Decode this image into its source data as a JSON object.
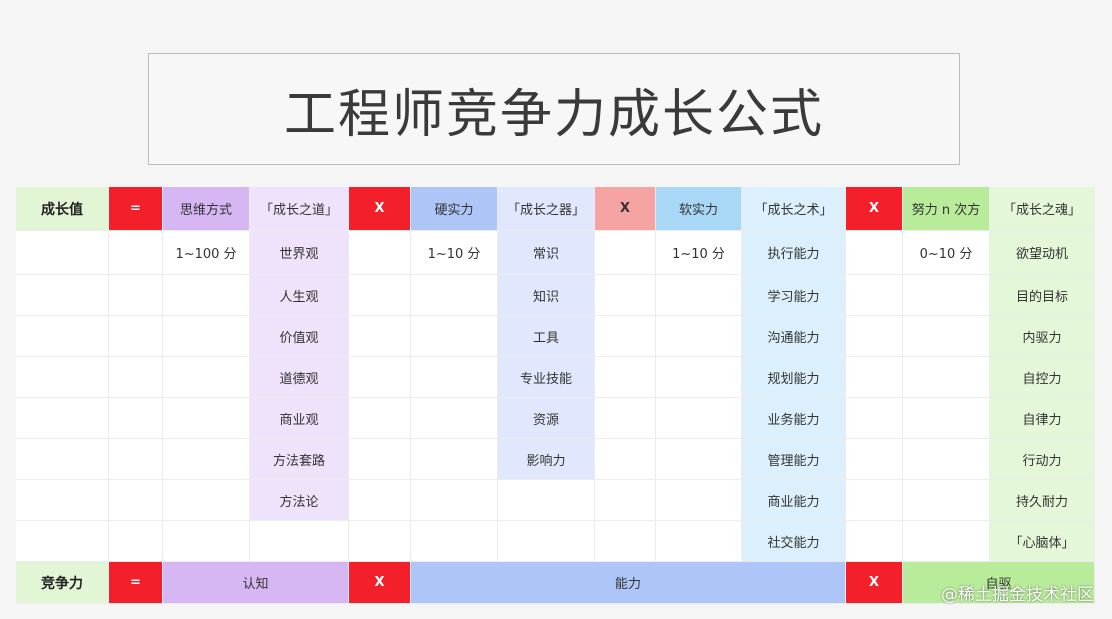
{
  "title": "工程师竞争力成长公式",
  "header": {
    "row_label": "成长值",
    "eq": "=",
    "thinking": "思维方式",
    "dao": "「成长之道」",
    "x1": "X",
    "hard": "硬实力",
    "qi": "「成长之器」",
    "x2": "X",
    "soft": "软实力",
    "shu": "「成长之术」",
    "x3": "X",
    "effort": "努力 n 次方",
    "hun": "「成长之魂」"
  },
  "ranges": {
    "thinking": "1~100 分",
    "hard": "1~10 分",
    "soft": "1~10 分",
    "effort": "0~10 分"
  },
  "dao_items": [
    "世界观",
    "人生观",
    "价值观",
    "道德观",
    "商业观",
    "方法套路",
    "方法论"
  ],
  "qi_items": [
    "常识",
    "知识",
    "工具",
    "专业技能",
    "资源",
    "影响力"
  ],
  "shu_items": [
    "执行能力",
    "学习能力",
    "沟通能力",
    "规划能力",
    "业务能力",
    "管理能力",
    "商业能力",
    "社交能力"
  ],
  "hun_items": [
    "欲望动机",
    "目的目标",
    "内驱力",
    "自控力",
    "自律力",
    "行动力",
    "持久耐力",
    "「心脑体」"
  ],
  "footer": {
    "row_label": "竞争力",
    "eq": "=",
    "cognition": "认知",
    "x1": "X",
    "ability": "能力",
    "x2": "X",
    "drive": "自驱"
  },
  "watermark": "@稀土掘金技术社区",
  "colors": {
    "operator_red": "#f31f2b",
    "operator_pink": "#f5a3a3",
    "purple": "#d6b6f3",
    "blue": "#aec6f7",
    "sky": "#a9d8f6",
    "green": "#b8ec9a"
  }
}
